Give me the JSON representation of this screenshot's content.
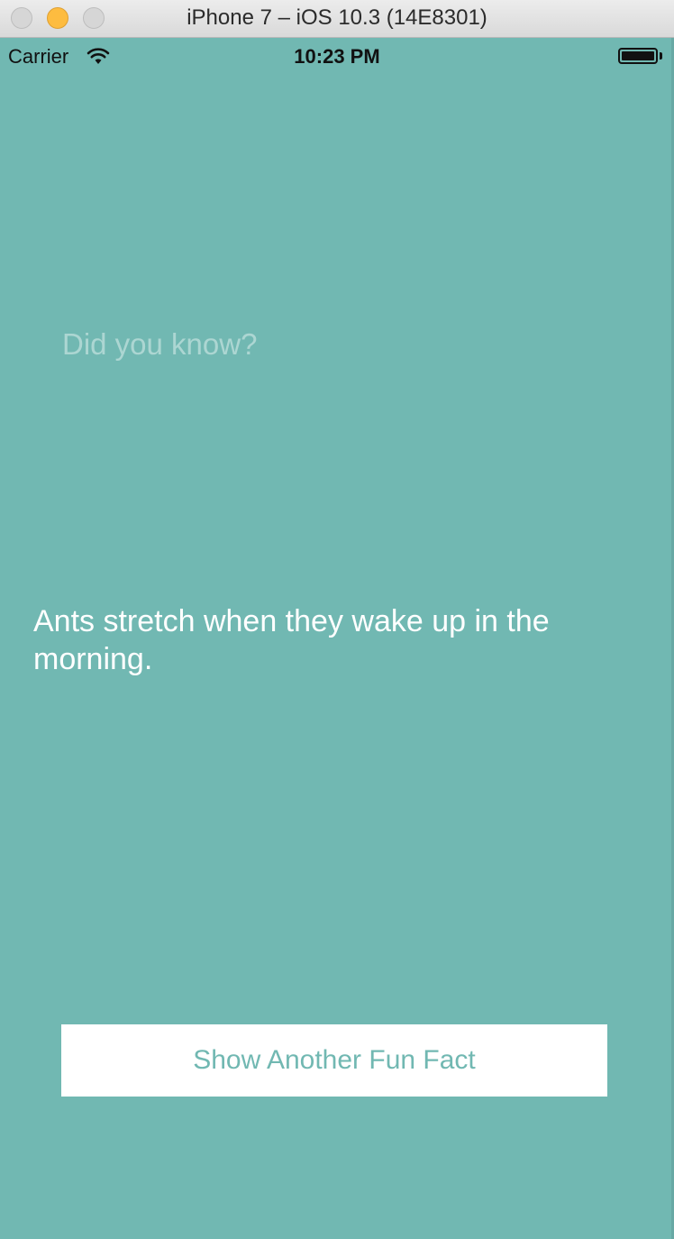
{
  "window": {
    "title": "iPhone 7 – iOS 10.3 (14E8301)"
  },
  "status_bar": {
    "carrier": "Carrier",
    "time": "10:23 PM",
    "wifi_icon": "wifi-icon",
    "battery_level": 1.0
  },
  "content": {
    "heading": "Did you know?",
    "fact": "Ants stretch when they wake up in the morning.",
    "button_label": "Show Another Fun Fact"
  },
  "colors": {
    "background": "#71b8b2",
    "button_background": "#ffffff",
    "button_text": "#71b8b2"
  }
}
